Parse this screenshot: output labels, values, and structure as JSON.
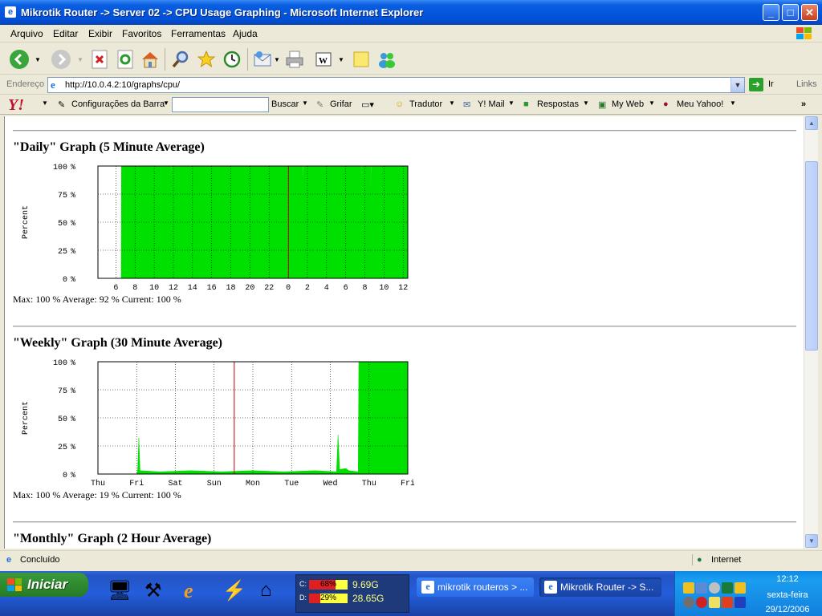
{
  "window": {
    "title": "Mikrotik Router -> Server 02 -> CPU Usage Graphing - Microsoft Internet Explorer",
    "controls": {
      "minimize": "_",
      "maximize": "□",
      "close": "✕"
    }
  },
  "menu": [
    "Arquivo",
    "Editar",
    "Exibir",
    "Favoritos",
    "Ferramentas",
    "Ajuda"
  ],
  "address": {
    "label": "Endereço",
    "url": "http://10.0.4.2:10/graphs/cpu/",
    "go": "Ir",
    "links": "Links"
  },
  "yahoo_toolbar": {
    "config": "Configurações da Barra",
    "search_value": "",
    "search_button": "Buscar",
    "highlight": "Grifar",
    "translator": "Tradutor",
    "mail": "Y! Mail",
    "answers": "Respostas",
    "myweb": "My Web",
    "myyahoo": "Meu Yahoo!",
    "more": "»"
  },
  "page": {
    "daily": {
      "title": "\"Daily\" Graph (5 Minute Average)",
      "stats": "Max: 100 %  Average: 92 %  Current: 100 %"
    },
    "weekly": {
      "title": "\"Weekly\" Graph (30 Minute Average)",
      "stats": "Max: 100 %  Average: 19 %  Current: 100 %"
    },
    "monthly": {
      "title": "\"Monthly\" Graph (2 Hour Average)"
    }
  },
  "chart_data": [
    {
      "type": "area",
      "ylabel": "Percent",
      "ylim": [
        0,
        100
      ],
      "y_ticks": [
        "100 %",
        "75 %",
        "50 %",
        "25 %",
        "0 %"
      ],
      "x_ticks": [
        "6",
        "8",
        "10",
        "12",
        "14",
        "16",
        "18",
        "20",
        "22",
        "0",
        "2",
        "4",
        "6",
        "8",
        "10",
        "12"
      ],
      "color": "#00e000",
      "marker_color": "#c00000",
      "series": [
        {
          "values": [
            [
              0,
              0
            ],
            [
              7.5,
              0
            ],
            [
              7.6,
              100
            ],
            [
              23.5,
              100
            ],
            [
              23.6,
              90
            ],
            [
              23.7,
              100
            ],
            [
              66,
              100
            ],
            [
              66.1,
              85
            ],
            [
              66.2,
              100
            ],
            [
              85,
              100
            ],
            [
              85.1,
              90
            ],
            [
              85.2,
              100
            ],
            [
              88,
              100
            ],
            [
              88.1,
              75
            ],
            [
              88.2,
              100
            ],
            [
              100,
              100
            ]
          ]
        }
      ],
      "marker_x": 61.5,
      "grid": true
    },
    {
      "type": "area",
      "ylabel": "Percent",
      "ylim": [
        0,
        100
      ],
      "y_ticks": [
        "100 %",
        "75 %",
        "50 %",
        "25 %",
        "0 %"
      ],
      "x_ticks": [
        "Thu",
        "Fri",
        "Sat",
        "Sun",
        "Mon",
        "Tue",
        "Wed",
        "Thu",
        "Fri"
      ],
      "color": "#00e000",
      "marker_color": "#c00000",
      "series": [
        {
          "values": [
            [
              0,
              0
            ],
            [
              12.5,
              0
            ],
            [
              12.8,
              2
            ],
            [
              13.2,
              32
            ],
            [
              13.6,
              3
            ],
            [
              20,
              2
            ],
            [
              30,
              3
            ],
            [
              40,
              2
            ],
            [
              50,
              3
            ],
            [
              60,
              2
            ],
            [
              70,
              3
            ],
            [
              77,
              2
            ],
            [
              77.5,
              35
            ],
            [
              78,
              4
            ],
            [
              80,
              5
            ],
            [
              81,
              3
            ],
            [
              84,
              2
            ],
            [
              84.2,
              100
            ],
            [
              100,
              100
            ]
          ]
        }
      ],
      "marker_x": 44,
      "grid": true
    }
  ],
  "status": {
    "text": "Concluído",
    "zone": "Internet"
  },
  "taskbar": {
    "start": "Iniciar",
    "meter": [
      {
        "drive": "C:",
        "percent": "68%",
        "fill": 0.68,
        "size": "9.69G"
      },
      {
        "drive": "D:",
        "percent": "29%",
        "fill": 0.29,
        "size": "28.65G"
      }
    ],
    "tasks": [
      {
        "label": "mikrotik routeros > ...",
        "active": false
      },
      {
        "label": "Mikrotik Router -> S...",
        "active": true
      }
    ],
    "clock": {
      "time": "12:12",
      "day": "sexta-feira",
      "date": "29/12/2006"
    }
  }
}
